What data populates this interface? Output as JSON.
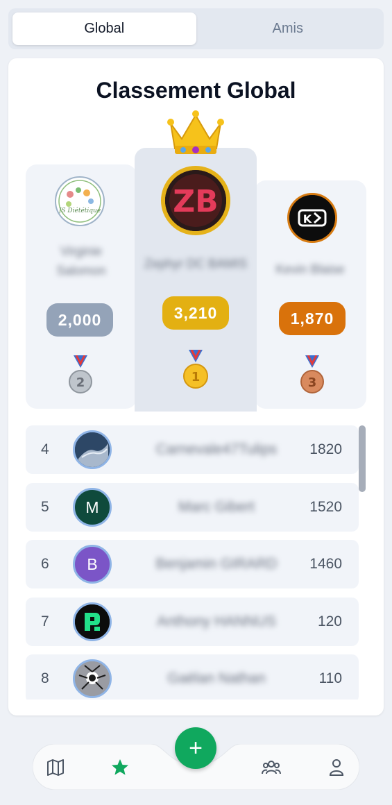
{
  "tabs": [
    {
      "label": "Global",
      "active": true
    },
    {
      "label": "Amis",
      "active": false
    }
  ],
  "leaderboard": {
    "title": "Classement Global",
    "podium": {
      "first": {
        "name": "Zephyr DC BAMIS",
        "score": "3,210",
        "medal": "1",
        "avatar_text": "ZB"
      },
      "second": {
        "name": "Virginie Salomon",
        "score": "2,000",
        "medal": "2",
        "avatar_text": "JS Diététique"
      },
      "third": {
        "name": "Kevin Blaise",
        "score": "1,870",
        "medal": "3",
        "avatar_text": "K"
      }
    },
    "rows": [
      {
        "rank": "4",
        "name": "Carnevale47Tulips",
        "score": "1820",
        "avatar": "photo"
      },
      {
        "rank": "5",
        "name": "Marc Gibert",
        "score": "1520",
        "avatar": "M"
      },
      {
        "rank": "6",
        "name": "Benjamin GIRARD",
        "score": "1460",
        "avatar": "B"
      },
      {
        "rank": "7",
        "name": "Anthony HANNUS",
        "score": "120",
        "avatar": "logo"
      },
      {
        "rank": "8",
        "name": "Gaëlan Nathan",
        "score": "110",
        "avatar": "photo"
      }
    ]
  },
  "nav": {
    "items": [
      "map-icon",
      "star-icon",
      "add-icon",
      "group-icon",
      "profile-icon"
    ],
    "fab_label": "+"
  },
  "colors": {
    "gold": "#e3b012",
    "silver": "#94a3b8",
    "bronze": "#d9720b",
    "accent": "#10a85e"
  }
}
